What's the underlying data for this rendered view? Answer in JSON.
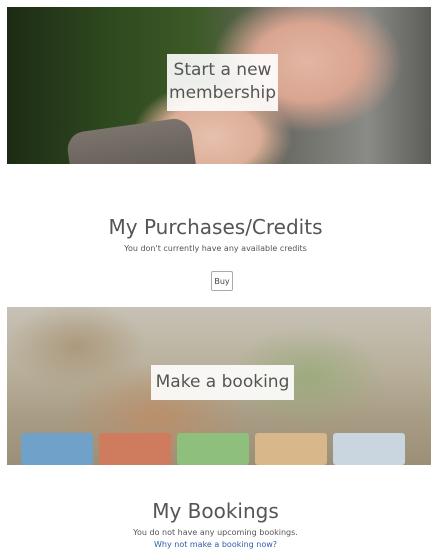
{
  "membership": {
    "label": "Start a new membership"
  },
  "purchases": {
    "title": "My Purchases/Credits",
    "message": "You don't currently have any available credits",
    "buy_label": "Buy"
  },
  "booking_banner": {
    "label": "Make a booking"
  },
  "bookings": {
    "title": "My Bookings",
    "message": "You do not have any upcoming bookings.",
    "link_text": "Why not make a booking now?"
  }
}
